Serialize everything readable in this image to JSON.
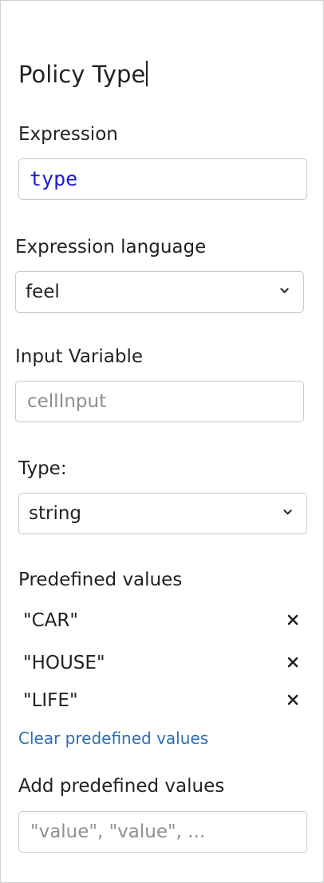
{
  "panel": {
    "title": "Policy Type",
    "expression": {
      "label": "Expression",
      "value": "type"
    },
    "expression_language": {
      "label": "Expression language",
      "selected": "feel",
      "icon": "chevron-down-icon"
    },
    "input_variable": {
      "label": "Input Variable",
      "placeholder": "cellInput"
    },
    "type": {
      "label": "Type:",
      "selected": "string",
      "icon": "chevron-down-icon"
    },
    "predefined": {
      "label": "Predefined values",
      "values": [
        "\"CAR\"",
        "\"HOUSE\"",
        "\"LIFE\""
      ],
      "remove_icon": "close-icon",
      "clear_label": "Clear predefined values"
    },
    "add_predefined": {
      "label": "Add predefined values",
      "placeholder": "\"value\", \"value\", ..."
    },
    "colors": {
      "expression_text": "#1d1dd0",
      "link": "#2a6ebb",
      "border": "#c8c8c8"
    }
  }
}
